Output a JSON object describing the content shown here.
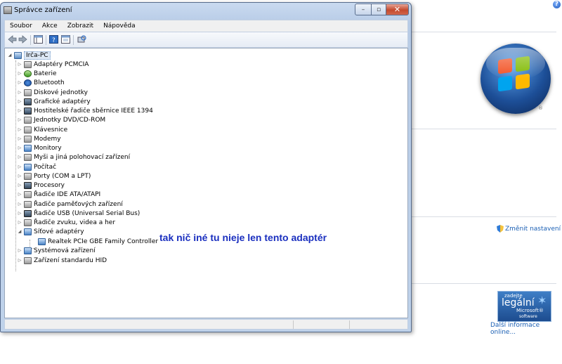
{
  "window": {
    "title": "Správce zařízení",
    "controls": {
      "minimize": "–",
      "maximize": "▫",
      "close": "✕"
    }
  },
  "menu": [
    "Soubor",
    "Akce",
    "Zobrazit",
    "Nápověda"
  ],
  "toolbar_icons": [
    "back-icon",
    "forward-icon",
    "console-tree-icon",
    "help-icon",
    "properties-icon",
    "scan-hardware-icon"
  ],
  "tree": {
    "root": "Irča-PC",
    "categories": [
      "Adaptéry PCMCIA",
      "Baterie",
      "Bluetooth",
      "Diskové jednotky",
      "Grafické adaptéry",
      "Hostitelské řadiče sběrnice IEEE 1394",
      "Jednotky DVD/CD-ROM",
      "Klávesnice",
      "Modemy",
      "Monitory",
      "Myši a jiná polohovací zařízení",
      "Počítač",
      "Porty (COM a LPT)",
      "Procesory",
      "Řadiče IDE ATA/ATAPI",
      "Řadiče paměťových zařízení",
      "Řadiče USB (Universal Serial Bus)",
      "Řadiče zvuku, videa a her",
      "Síťové adaptéry"
    ],
    "network_child": "Realtek PCIe GBE Family Controller",
    "after": [
      "Systémová zařízení",
      "Zařízení standardu HID"
    ]
  },
  "annotation": "tak nič iné tu nieje len tento adaptér",
  "side_panel": {
    "help": "?",
    "windows_reg": "®",
    "change_settings": "Změnit nastavení",
    "genuine_badge": {
      "line1": "zadejte",
      "line2": "legální",
      "line3": "Microsoft®",
      "line4": "software"
    },
    "more_info": "Další informace online..."
  }
}
